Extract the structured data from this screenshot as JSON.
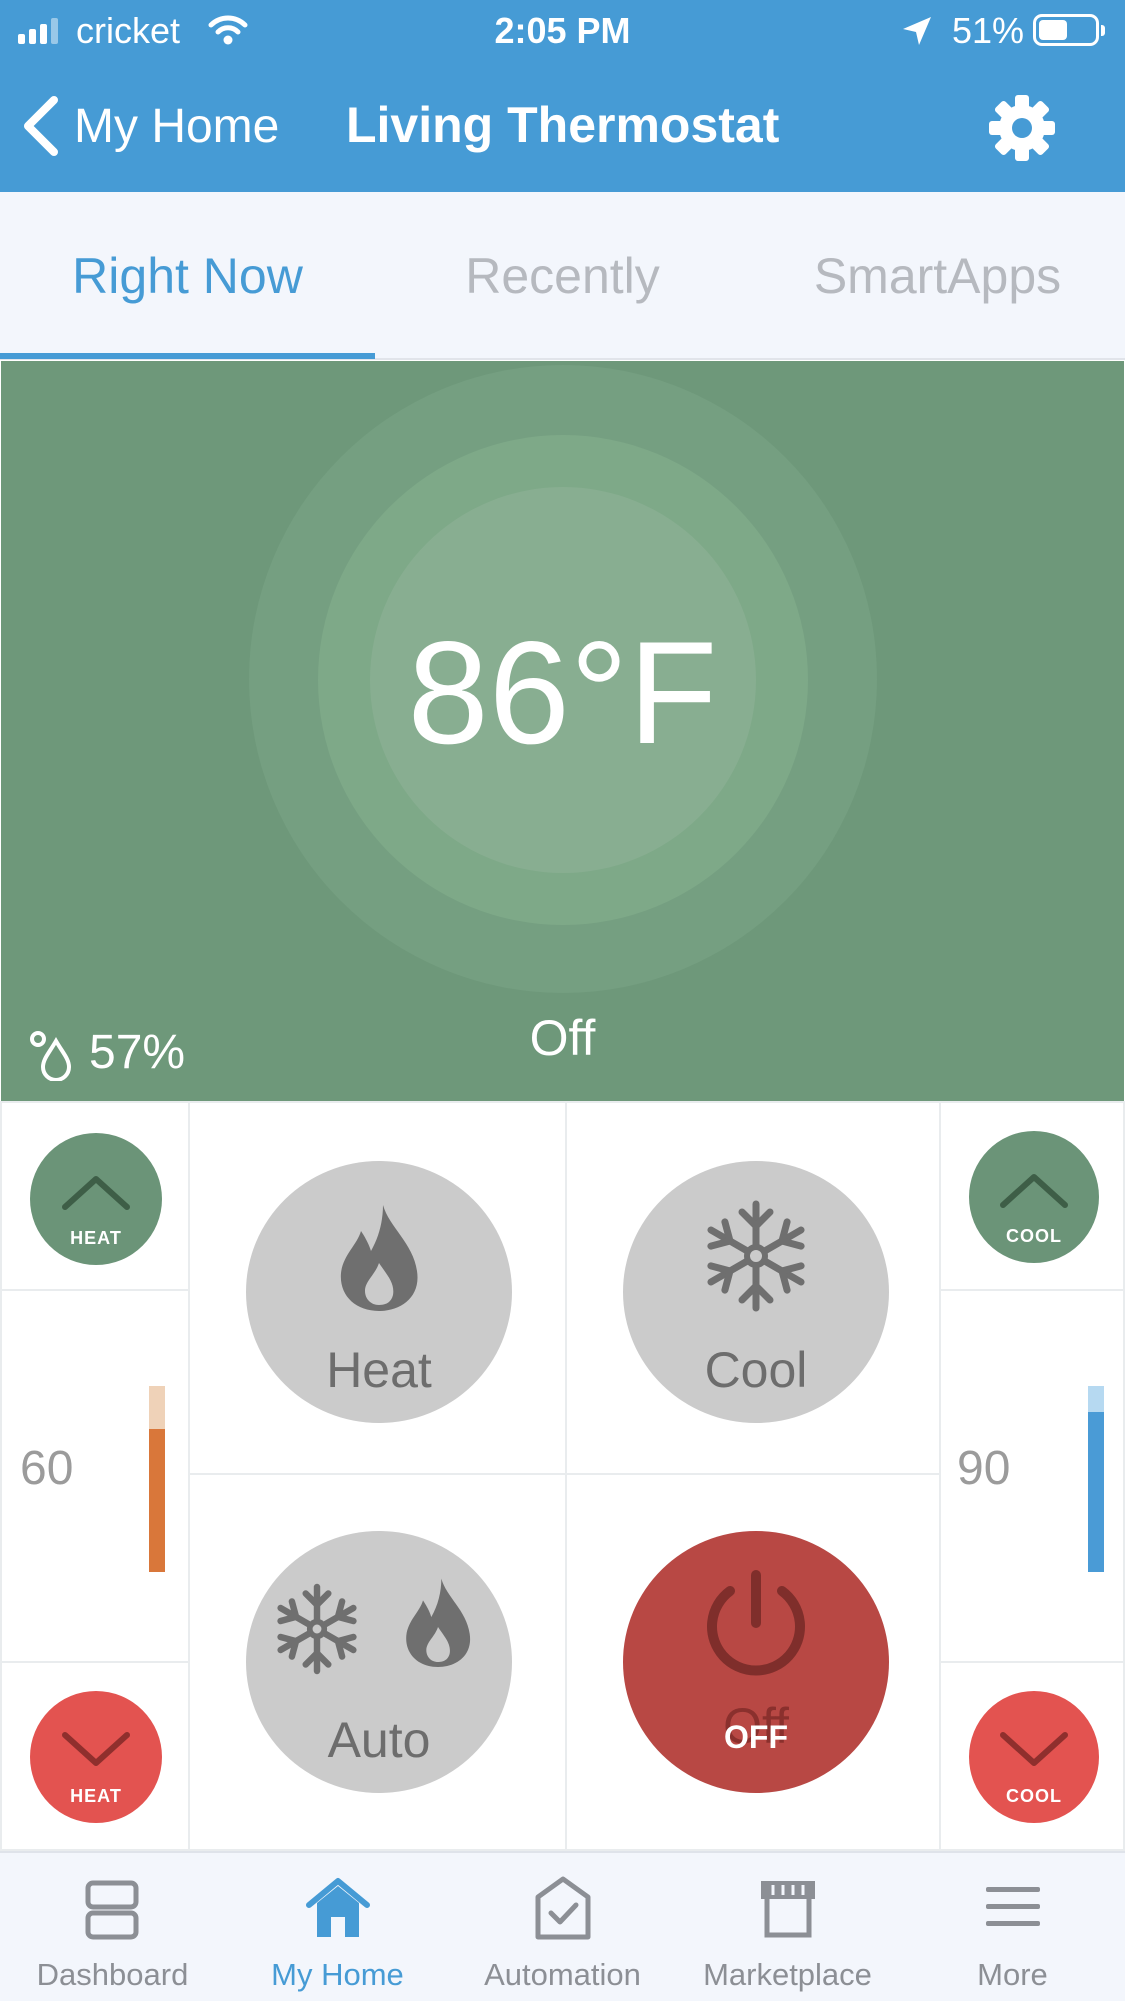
{
  "status_bar": {
    "carrier": "cricket",
    "time": "2:05 PM",
    "battery": "51%",
    "battery_level": 0.51
  },
  "nav": {
    "back_label": "My Home",
    "title": "Living Thermostat",
    "settings_icon": "gear-icon"
  },
  "tabs": [
    {
      "label": "Right Now",
      "active": true
    },
    {
      "label": "Recently",
      "active": false
    },
    {
      "label": "SmartApps",
      "active": false
    }
  ],
  "hero": {
    "temperature": "86°F",
    "humidity": "57%",
    "mode_status": "Off"
  },
  "controls": {
    "heat_up_label": "HEAT",
    "heat_down_label": "HEAT",
    "cool_up_label": "COOL",
    "cool_down_label": "COOL",
    "heat_setpoint": "60",
    "cool_setpoint": "90",
    "heat_mode_label": "Heat",
    "cool_mode_label": "Cool",
    "auto_mode_label": "Auto",
    "off_mode_label": "Off",
    "off_badge": "OFF"
  },
  "bottom_nav": [
    {
      "label": "Dashboard",
      "icon": "dashboard-icon",
      "active": false
    },
    {
      "label": "My Home",
      "icon": "home-icon",
      "active": true
    },
    {
      "label": "Automation",
      "icon": "automation-icon",
      "active": false
    },
    {
      "label": "Marketplace",
      "icon": "marketplace-icon",
      "active": false
    },
    {
      "label": "More",
      "icon": "menu-icon",
      "active": false
    }
  ],
  "colors": {
    "brand_blue": "#469bd5",
    "hero_green": "#6e987a",
    "control_green": "#6b9478",
    "down_red": "#e35350",
    "off_red": "#b84844",
    "heat_orange": "#d9773a",
    "cool_blue": "#4a9bd6"
  }
}
